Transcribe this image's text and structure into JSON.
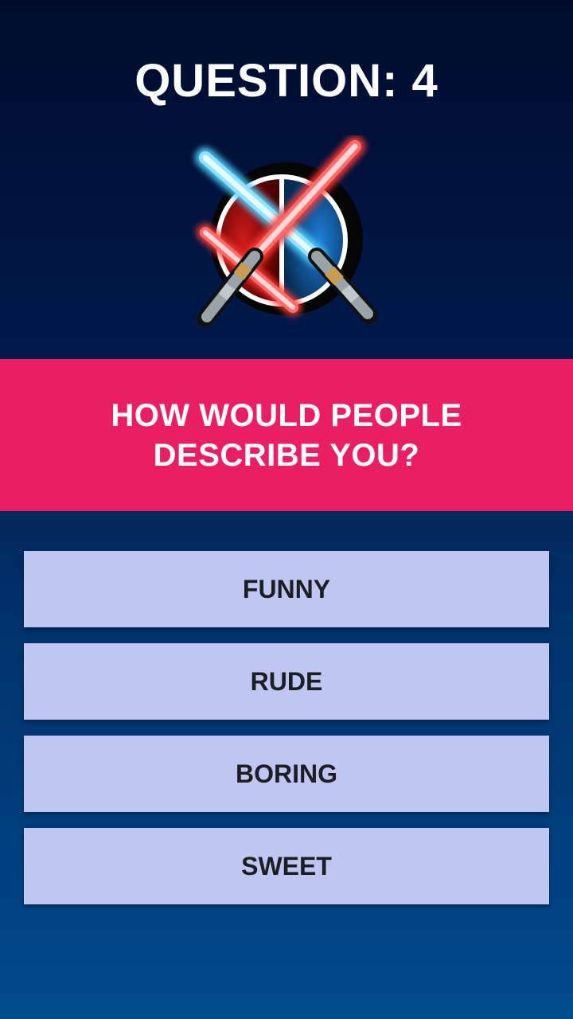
{
  "header": {
    "question_label": "QUESTION: 4",
    "emblem_icon": "crossed-lightsabers-icon"
  },
  "question": {
    "text": "HOW WOULD PEOPLE DESCRIBE YOU?"
  },
  "answers": [
    {
      "label": "FUNNY"
    },
    {
      "label": "RUDE"
    },
    {
      "label": "BORING"
    },
    {
      "label": "SWEET"
    }
  ],
  "colors": {
    "background_top": "#000b2c",
    "background_bottom": "#014a8e",
    "question_band": "#e91e63",
    "answer_button": "#c0c6f2",
    "answer_text": "#1d1d24",
    "saber_blue": "#4fd1ff",
    "saber_red": "#ff4a4a"
  }
}
